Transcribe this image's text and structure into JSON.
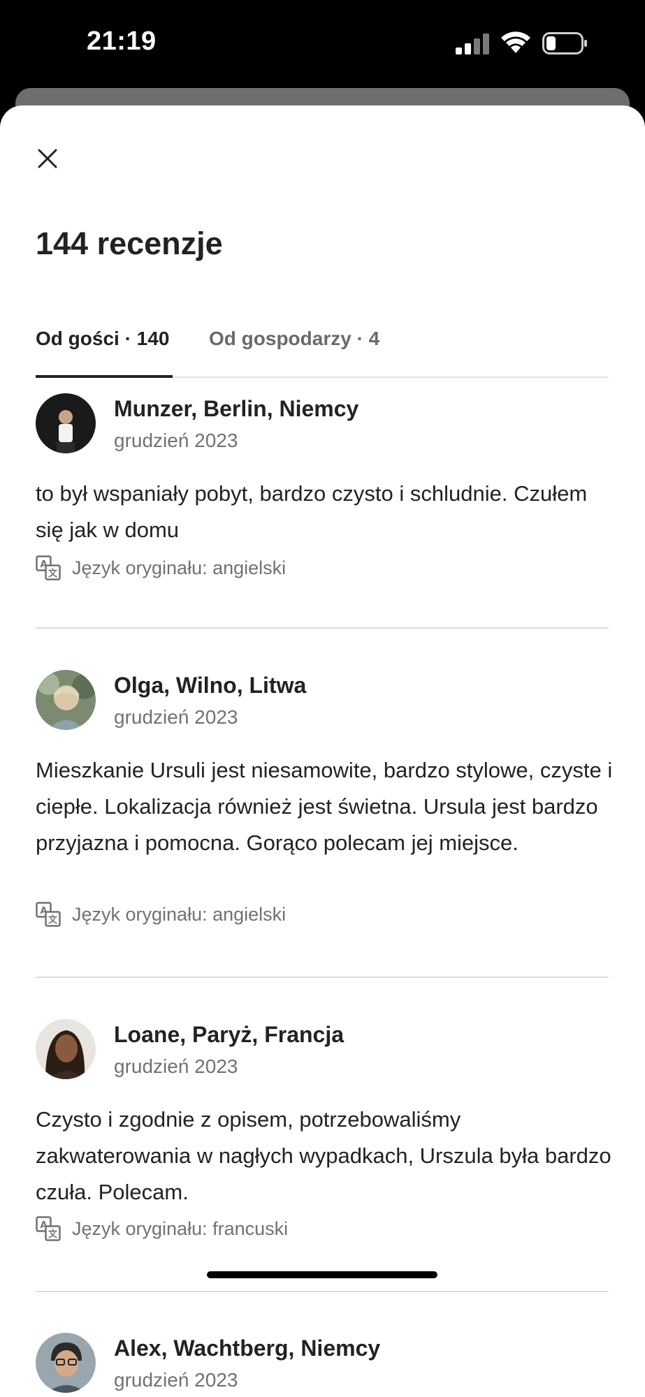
{
  "status_bar": {
    "time": "21:19"
  },
  "sheet": {
    "title": "144 recenzje",
    "tabs": [
      {
        "label": "Od gości · 140",
        "active": true
      },
      {
        "label": "Od gospodarzy · 4",
        "active": false
      }
    ]
  },
  "reviews": [
    {
      "name": "Munzer, Berlin, Niemcy",
      "date": "grudzień 2023",
      "text": "to był wspaniały pobyt, bardzo czysto i schludnie. Czułem się jak w domu",
      "original_language": "Język oryginału: angielski"
    },
    {
      "name": "Olga, Wilno, Litwa",
      "date": "grudzień 2023",
      "text": "Mieszkanie Ursuli jest niesamowite, bardzo stylowe, czyste i ciepłe. Lokalizacja również jest świetna. Ursula jest bardzo przyjazna i pomocna. Gorąco polecam jej miejsce.",
      "original_language": "Język oryginału: angielski"
    },
    {
      "name": "Loane, Paryż, Francja",
      "date": "grudzień 2023",
      "text": "Czysto i zgodnie z opisem, potrzebowaliśmy zakwaterowania w nagłych wypadkach, Urszula była bardzo czuła. Polecam.",
      "original_language": "Język oryginału: francuski"
    },
    {
      "name": "Alex, Wachtberg, Niemcy",
      "date": "grudzień 2023"
    }
  ],
  "colors": {
    "text_primary": "#222222",
    "text_secondary": "#717171",
    "divider": "#dddddd",
    "background": "#ffffff"
  },
  "icons": {
    "close": "close-icon",
    "translate": "translate-icon",
    "signal": "cellular-signal-icon",
    "wifi": "wifi-icon",
    "battery": "battery-icon"
  }
}
